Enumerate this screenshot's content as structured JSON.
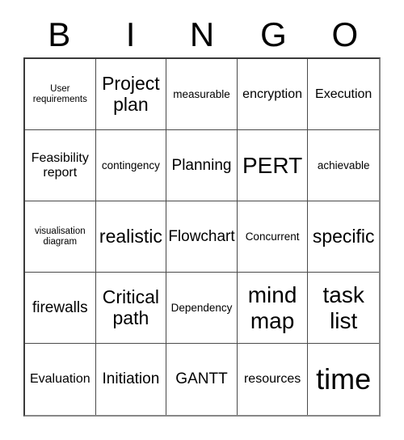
{
  "card": {
    "header": {
      "letters": [
        "B",
        "I",
        "N",
        "G",
        "O"
      ]
    },
    "columns": 5,
    "rows": 5,
    "cells": [
      {
        "text": "User requirements",
        "size": "fs-xs"
      },
      {
        "text": "Project plan",
        "size": "fs-xl"
      },
      {
        "text": "measurable",
        "size": "fs-sm"
      },
      {
        "text": "encryption",
        "size": "fs-md"
      },
      {
        "text": "Execution",
        "size": "fs-md"
      },
      {
        "text": "Feasibility report",
        "size": "fs-md"
      },
      {
        "text": "contingency",
        "size": "fs-sm"
      },
      {
        "text": "Planning",
        "size": "fs-lg"
      },
      {
        "text": "PERT",
        "size": "fs-xxl"
      },
      {
        "text": "achievable",
        "size": "fs-sm"
      },
      {
        "text": "visualisation diagram",
        "size": "fs-xs"
      },
      {
        "text": "realistic",
        "size": "fs-xl"
      },
      {
        "text": "Flowchart",
        "size": "fs-lg"
      },
      {
        "text": "Concurrent",
        "size": "fs-sm"
      },
      {
        "text": "specific",
        "size": "fs-xl"
      },
      {
        "text": "firewalls",
        "size": "fs-lg"
      },
      {
        "text": "Critical path",
        "size": "fs-xl"
      },
      {
        "text": "Dependency",
        "size": "fs-sm"
      },
      {
        "text": "mind map",
        "size": "fs-xxl"
      },
      {
        "text": "task list",
        "size": "fs-xxl"
      },
      {
        "text": "Evaluation",
        "size": "fs-md"
      },
      {
        "text": "Initiation",
        "size": "fs-lg"
      },
      {
        "text": "GANTT",
        "size": "fs-lg"
      },
      {
        "text": "resources",
        "size": "fs-md"
      },
      {
        "text": "time",
        "size": "fs-huge"
      }
    ],
    "colors": {
      "background": "#ffffff",
      "text": "#000000",
      "grid_line": "#4a4a4a",
      "outer_border": "#3a3a3a"
    }
  }
}
